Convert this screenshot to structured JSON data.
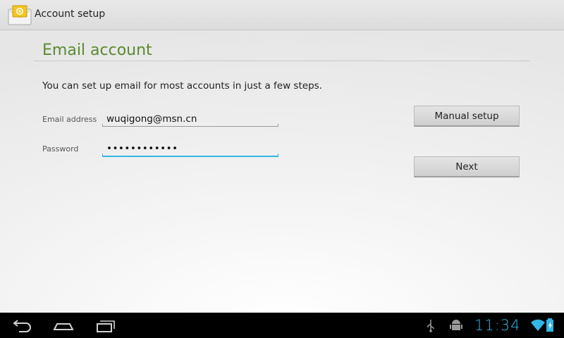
{
  "app": {
    "title": "Account setup",
    "icon": "email-envelope-icon"
  },
  "section": {
    "title": "Email account",
    "intro": "You can set up email for most accounts in just a few steps."
  },
  "form": {
    "email_label": "Email address",
    "email_value": "wuqigong@msn.cn",
    "password_label": "Password",
    "password_value": "••••••••••••"
  },
  "buttons": {
    "manual_setup": "Manual setup",
    "next": "Next"
  },
  "navbar": {
    "back": "back-icon",
    "home": "home-icon",
    "recents": "recent-apps-icon"
  },
  "status": {
    "time": "11:34",
    "icons": [
      "usb-icon",
      "android-debug-icon",
      "wifi-icon",
      "battery-icon"
    ]
  },
  "colors": {
    "accent": "#33b5e5",
    "title_green": "#5b8a2f"
  }
}
